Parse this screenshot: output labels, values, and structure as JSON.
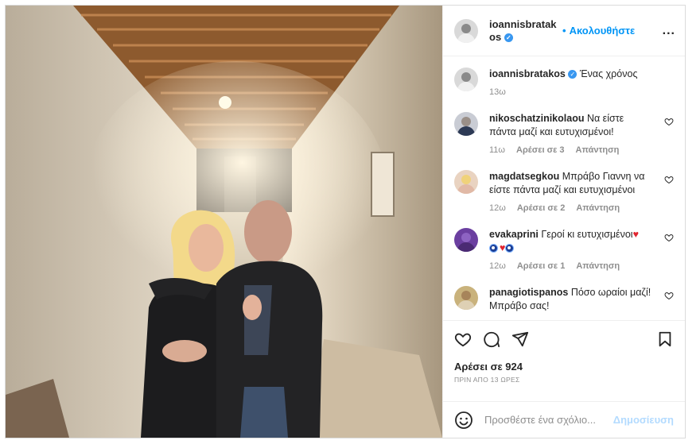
{
  "header": {
    "username": "ioannisbratakos",
    "follow_label": "Ακολουθήστε",
    "dot": "•",
    "more": "..."
  },
  "caption": {
    "username": "ioannisbratakos",
    "text": "Ένας χρόνος",
    "time": "13ω"
  },
  "comments": [
    {
      "username": "nikoschatzinikolaou",
      "text": "Να είστε πάντα μαζί και ευτυχισμένοι!",
      "time": "11ω",
      "likes": "Αρέσει σε 3",
      "reply": "Απάντηση"
    },
    {
      "username": "magdatsegkou",
      "text": "Μπράβο Γιαννη να είστε πάντα μαζί και ευτυχισμένοι",
      "time": "12ω",
      "likes": "Αρέσει σε 2",
      "reply": "Απάντηση"
    },
    {
      "username": "evakaprini",
      "text": "Γεροί κι ευτυχισμένοι",
      "time": "12ω",
      "likes": "Αρέσει σε 1",
      "reply": "Απάντηση"
    },
    {
      "username": "panagiotispanos",
      "text": "Πόσο ωραίοι μαζί! Μπράβο σας!",
      "time": "",
      "likes": "",
      "reply": ""
    }
  ],
  "post": {
    "likes": "Αρέσει σε 924",
    "time_ago": "ΠΡΙΝ ΑΠΟ 13 ΩΡΕΣ"
  },
  "add_comment": {
    "placeholder": "Προσθέστε ένα σχόλιο...",
    "post_label": "Δημοσίευση"
  },
  "colors": {
    "accent": "#0095f6",
    "verified": "#3897f0",
    "post_disabled": "#b3dbff",
    "muted": "#8e8e8e"
  },
  "icons": [
    "heart-icon",
    "comment-icon",
    "share-icon",
    "bookmark-icon",
    "emoji-icon",
    "verified-icon",
    "more-options-icon"
  ]
}
